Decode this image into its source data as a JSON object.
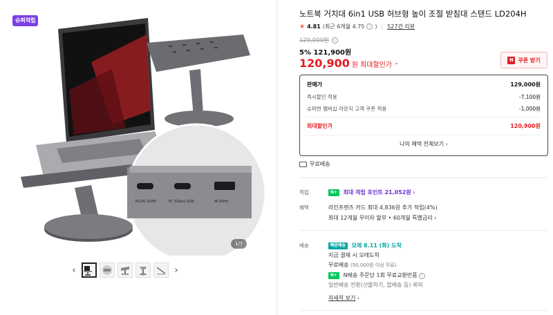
{
  "gallery": {
    "badge": "슈퍼적립",
    "counter": "1/7",
    "prev_icon": "chevron-left-icon",
    "next_icon": "chevron-right-icon",
    "thumb_count": 5,
    "callout_ports": [
      "PD-IN 100W",
      "PC 5Gbps 92W",
      "4k 60Hz"
    ]
  },
  "product": {
    "title": "노트북 거치대 6in1 USB 허브형 높이 조절 받침대 스탠드 LD204H",
    "rating": "4.81",
    "recent_rating": "(최근 6개월 4.75",
    "recent_rating_close": ")",
    "reviews": "527건 리뷰",
    "original_price": "129,000원",
    "discount_line": "5% 121,900원",
    "final_price": "120,900",
    "final_unit": "원",
    "final_label": "최대할인가",
    "coupon_label": "쿠폰 받기",
    "coupon_n": "N"
  },
  "price_breakdown": {
    "rows": [
      {
        "label": "판매가",
        "value": "129,000원"
      },
      {
        "label": "즉시할인 적용",
        "value": "-7,100원"
      },
      {
        "label": "슈퍼연 멤버십 라운지 고객 쿠폰 적용",
        "value": "-1,000원"
      }
    ],
    "max_label": "최대할인가",
    "max_value": "120,900원",
    "all_benefits": "나의 혜택 전체보기"
  },
  "shipping_free": "무료배송",
  "points": {
    "label": "적립",
    "badge": "N+",
    "text": "최대 적립 포인트 21,052원"
  },
  "benefits": {
    "label": "혜택",
    "line1": "라인프렌즈 카드 최대 4,836원 추가 적립(4%)",
    "line2": "최대 12개월 무이자 할부 • 60개월 특별금리"
  },
  "delivery": {
    "label": "배송",
    "fast_badge": "빠른배송",
    "fast_text": "모레 8.11 (화) 도착",
    "line1": "지금 결제 시 모레도착",
    "line2": "무료배송",
    "line3": "(50,000원 이상 무료)",
    "nbadge": "N+",
    "line4": "N배송 주문당 1회 무료교환반품",
    "line5": "일반배송 전환(선물하기, 합배송 등) 제외",
    "more": "자세히 보기"
  }
}
